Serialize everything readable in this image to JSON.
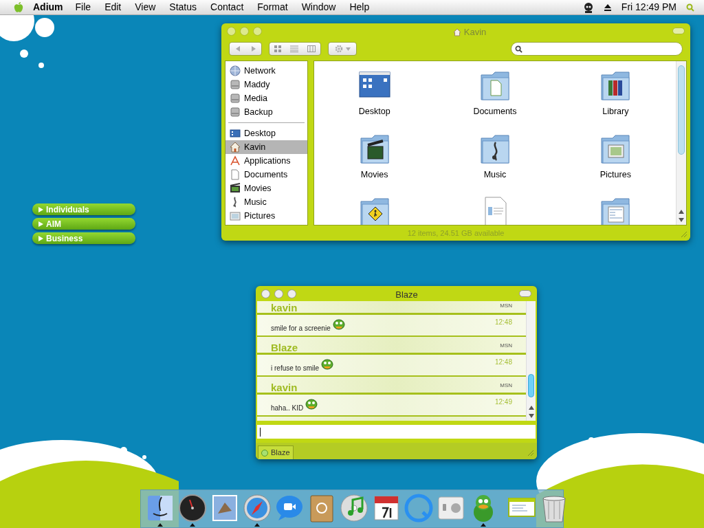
{
  "menu_bar": {
    "app_name": "Adium",
    "menus": [
      "File",
      "Edit",
      "View",
      "Status",
      "Contact",
      "Format",
      "Window",
      "Help"
    ],
    "clock": "Fri 12:49 PM"
  },
  "contact_groups": [
    {
      "label": "Individuals",
      "expanded": false
    },
    {
      "label": "AIM",
      "expanded": false
    },
    {
      "label": "Business",
      "expanded": false
    }
  ],
  "finder": {
    "title": "Kavin",
    "devices": [
      {
        "label": "Network",
        "kind": "globe",
        "selected": false
      },
      {
        "label": "Maddy",
        "kind": "disk",
        "selected": false
      },
      {
        "label": "Media",
        "kind": "disk",
        "selected": false
      },
      {
        "label": "Backup",
        "kind": "disk",
        "selected": false
      }
    ],
    "places": [
      {
        "label": "Desktop",
        "kind": "desktop",
        "selected": false
      },
      {
        "label": "Kavin",
        "kind": "home",
        "selected": true
      },
      {
        "label": "Applications",
        "kind": "apps",
        "selected": false
      },
      {
        "label": "Documents",
        "kind": "doc",
        "selected": false
      },
      {
        "label": "Movies",
        "kind": "movie",
        "selected": false
      },
      {
        "label": "Music",
        "kind": "music",
        "selected": false
      },
      {
        "label": "Pictures",
        "kind": "pictures",
        "selected": false
      }
    ],
    "items": [
      {
        "label": "Desktop",
        "kind": "desktop"
      },
      {
        "label": "Documents",
        "kind": "folder-doc"
      },
      {
        "label": "Library",
        "kind": "folder-books"
      },
      {
        "label": "Movies",
        "kind": "folder-movie"
      },
      {
        "label": "Music",
        "kind": "folder-music"
      },
      {
        "label": "Pictures",
        "kind": "folder-pictures"
      },
      {
        "kind": "folder-public"
      },
      {
        "kind": "document"
      },
      {
        "kind": "folder-sites"
      }
    ],
    "status": "12 items, 24.51 GB available"
  },
  "chat": {
    "title": "Blaze",
    "messages": [
      {
        "sender": "kavin",
        "service": "MSN",
        "text": "smile for a screenie",
        "time": "12:48"
      },
      {
        "sender": "Blaze",
        "service": "MSN",
        "text": "i refuse to smile",
        "time": "12:48"
      },
      {
        "sender": "kavin",
        "service": "MSN",
        "text": "haha.. KID",
        "time": "12:49"
      }
    ],
    "tab": {
      "label": "Blaze",
      "online": true
    }
  },
  "dock": [
    {
      "kind": "finder",
      "running": true
    },
    {
      "kind": "dashboard",
      "running": true
    },
    {
      "kind": "mail",
      "running": false
    },
    {
      "kind": "safari",
      "running": true
    },
    {
      "kind": "ichat",
      "running": false
    },
    {
      "kind": "addressbook",
      "running": false
    },
    {
      "kind": "itunes",
      "running": false
    },
    {
      "kind": "ical",
      "running": false
    },
    {
      "kind": "quicktime",
      "running": false
    },
    {
      "kind": "prefs",
      "running": false
    },
    {
      "kind": "adium",
      "running": true
    },
    {
      "kind": "window",
      "running": false
    },
    {
      "kind": "trash",
      "running": false
    }
  ]
}
